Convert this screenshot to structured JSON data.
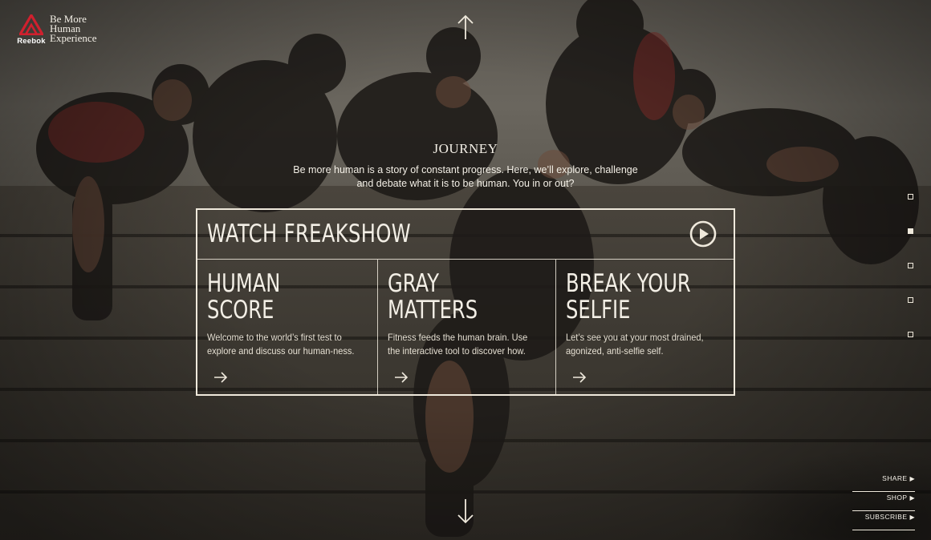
{
  "brand": {
    "name": "Reebok",
    "tagline": "Be More\nHuman\nExperience"
  },
  "intro": {
    "title": "JOURNEY",
    "text": "Be more human is a story of constant progress. Here, we’ll explore, challenge and debate what it is to be human. You in or out?"
  },
  "watch": {
    "label": "WATCH FREAKSHOW"
  },
  "cards": [
    {
      "title": "HUMAN\nSCORE",
      "description": "Welcome to the world’s first test to explore and discuss our human-ness."
    },
    {
      "title": "GRAY\nMATTERS",
      "description": "Fitness feeds the human brain. Use the interactive tool to discover how."
    },
    {
      "title": "BREAK YOUR\nSELFIE",
      "description": "Let’s see you at your most drained, agonized, anti-selfie self."
    }
  ],
  "side_nav": {
    "count": 5,
    "active_index": 1
  },
  "footer_links": [
    "SHARE",
    "SHOP",
    "SUBSCRIBE"
  ],
  "icons": {
    "logo": "reebok-delta-logo-icon",
    "up": "arrow-up-icon",
    "down": "arrow-down-icon",
    "play": "play-circle-icon",
    "card_arrow": "arrow-right-icon",
    "link_arrow": "triangle-right-icon"
  },
  "colors": {
    "brand_red": "#d0202e",
    "line": "#efe9dc",
    "text": "#f3efe6"
  }
}
